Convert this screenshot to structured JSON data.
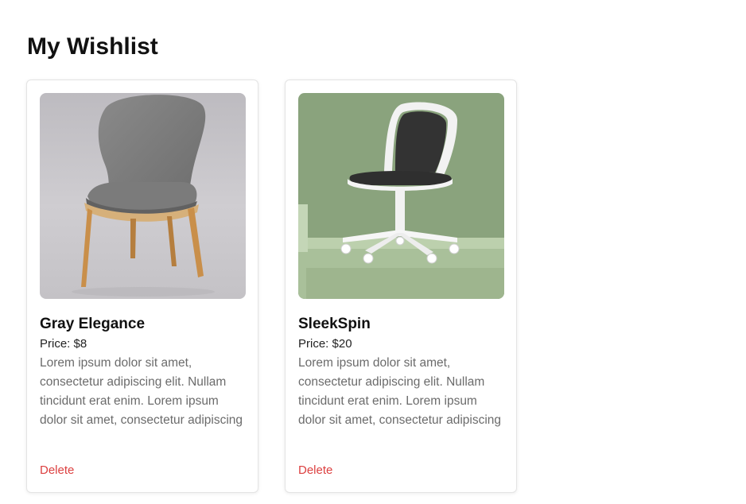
{
  "page": {
    "title": "My Wishlist"
  },
  "products": [
    {
      "name": "Gray Elegance",
      "price": "Price: $8",
      "description": "Lorem ipsum dolor sit amet, consectetur adipiscing elit. Nullam tincidunt erat enim. Lorem ipsum dolor sit amet, consectetur adipiscing",
      "delete_label": "Delete",
      "image": "gray upholstered chair with wooden legs"
    },
    {
      "name": "SleekSpin",
      "price": "Price: $20",
      "description": "Lorem ipsum dolor sit amet, consectetur adipiscing elit. Nullam tincidunt erat enim. Lorem ipsum dolor sit amet, consectetur adipiscing",
      "delete_label": "Delete",
      "image": "white swivel office chair on green background"
    }
  ],
  "colors": {
    "delete": "#dc4040",
    "description": "#6b6b6b",
    "card_border": "#e4e4e4",
    "green_backdrop": "#8aa37d"
  }
}
